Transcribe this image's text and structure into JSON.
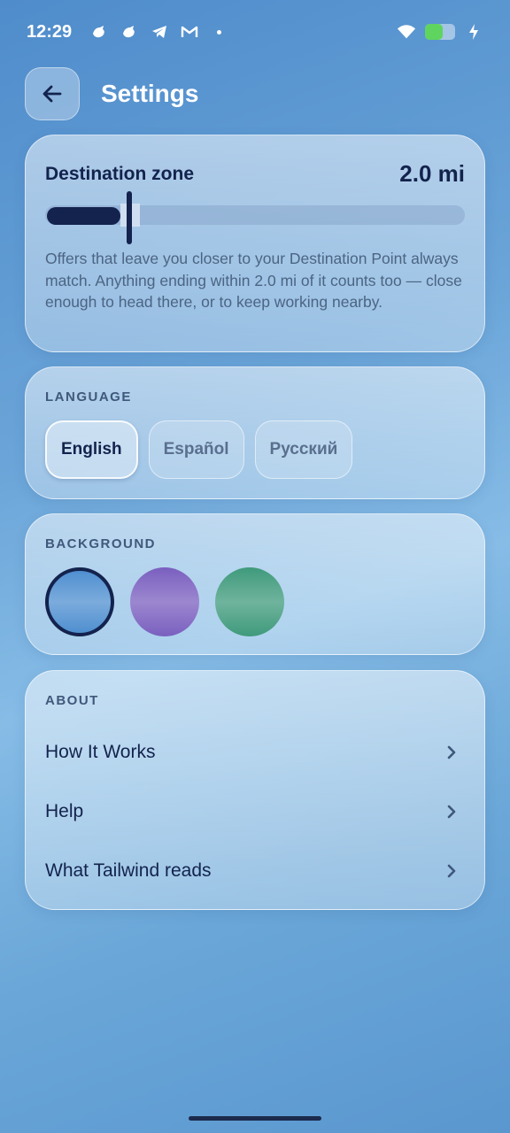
{
  "status_bar": {
    "time": "12:29",
    "notification_icons": [
      "bird-icon",
      "bird-icon",
      "telegram-icon",
      "gmail-icon",
      "dot-icon"
    ],
    "battery_level": 0.6,
    "colors": {
      "battery_fill": "#5fd45f"
    }
  },
  "header": {
    "title": "Settings",
    "back_icon": "arrow-left-icon"
  },
  "destination_zone": {
    "title": "Destination zone",
    "value": "2.0 mi",
    "slider_fraction": 0.2,
    "description": "Offers that leave you closer to your Destination Point always match. Anything ending within 2.0 mi of it counts too — close enough to head there, or to keep working nearby."
  },
  "language": {
    "label": "LANGUAGE",
    "options": [
      "English",
      "Español",
      "Русский"
    ],
    "selected": "English"
  },
  "background": {
    "label": "BACKGROUND",
    "swatches": [
      {
        "name": "blue",
        "color": "#4f8fd0",
        "selected": true
      },
      {
        "name": "purple",
        "color": "#7a5fbf",
        "selected": false
      },
      {
        "name": "green",
        "color": "#3f9a7c",
        "selected": false
      }
    ]
  },
  "about": {
    "label": "ABOUT",
    "items": [
      "How It Works",
      "Help",
      "What Tailwind reads"
    ]
  },
  "colors": {
    "accent": "#13234d",
    "text_secondary": "#4c6483"
  }
}
